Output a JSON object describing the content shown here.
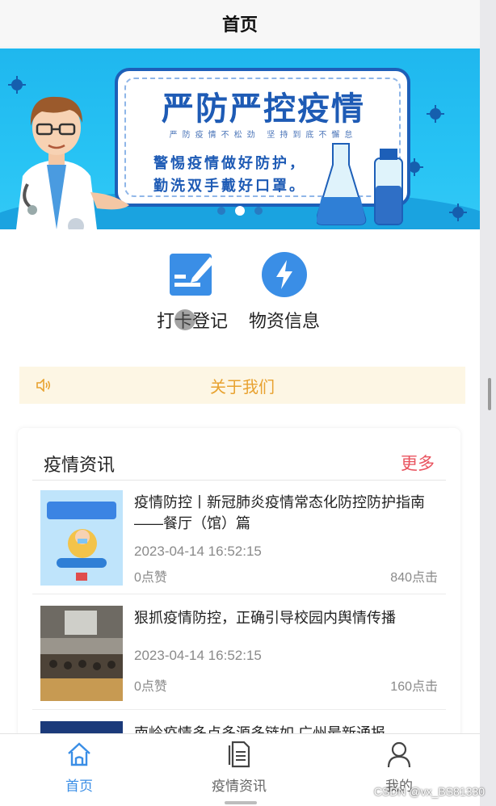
{
  "nav": {
    "title": "首页"
  },
  "banner": {
    "title": "严防严控疫情",
    "subtitle": "严防疫情不松劲 坚持到底不懈怠",
    "line1": "警惕疫情做好防护，",
    "line2": "勤洗双手戴好口罩。",
    "active_slide": 2,
    "slide_count": 3
  },
  "shortcuts": [
    {
      "label": "打卡登记",
      "icon": "edit-icon"
    },
    {
      "label": "物资信息",
      "icon": "lightning-icon"
    }
  ],
  "notice": {
    "text": "关于我们",
    "icon": "speaker-icon"
  },
  "news_card": {
    "title": "疫情资讯",
    "more_label": "更多",
    "items": [
      {
        "title": "疫情防控丨新冠肺炎疫情常态化防控防护指南——餐厅（馆）篇",
        "date": "2023-04-14 16:52:15",
        "likes": "0点赞",
        "clicks": "840点击"
      },
      {
        "title": "狠抓疫情防控，正确引导校园内舆情传播",
        "date": "2023-04-14 16:52:15",
        "likes": "0点赞",
        "clicks": "160点击"
      },
      {
        "title": "南岭疫情多点多源多链如 广州最新通报",
        "date": "",
        "likes": "",
        "clicks": ""
      }
    ]
  },
  "tabs": [
    {
      "label": "首页",
      "icon": "home-icon",
      "active": true
    },
    {
      "label": "疫情资讯",
      "icon": "document-icon",
      "active": false
    },
    {
      "label": "我的",
      "icon": "user-icon",
      "active": false
    }
  ],
  "watermark": "CSDN @vx_BS81330",
  "colors": {
    "accent": "#3a8ee6",
    "more": "#e9545f",
    "notice_text": "#e8a230",
    "notice_bg": "#fdf6e4"
  }
}
